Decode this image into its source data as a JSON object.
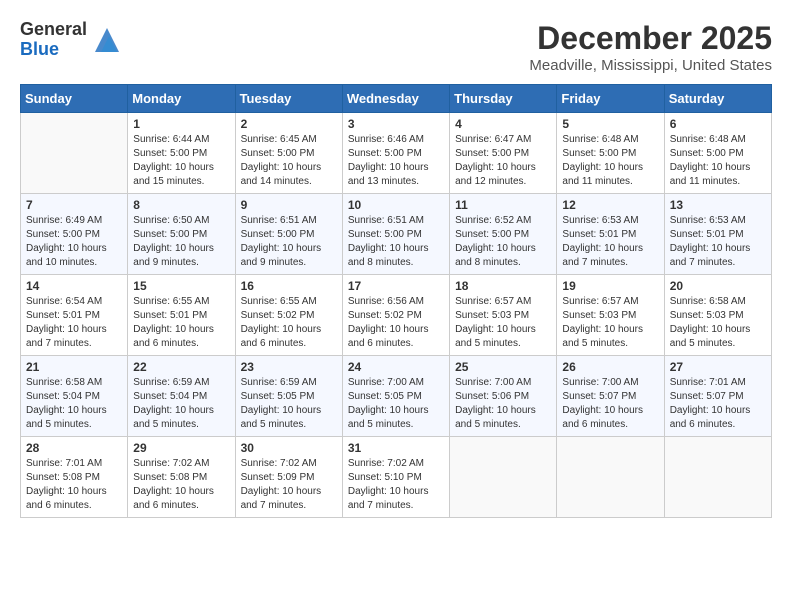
{
  "logo": {
    "general": "General",
    "blue": "Blue"
  },
  "header": {
    "month": "December 2025",
    "location": "Meadville, Mississippi, United States"
  },
  "weekdays": [
    "Sunday",
    "Monday",
    "Tuesday",
    "Wednesday",
    "Thursday",
    "Friday",
    "Saturday"
  ],
  "weeks": [
    [
      {
        "day": "",
        "empty": true
      },
      {
        "day": "1",
        "sunrise": "Sunrise: 6:44 AM",
        "sunset": "Sunset: 5:00 PM",
        "daylight": "Daylight: 10 hours and 15 minutes."
      },
      {
        "day": "2",
        "sunrise": "Sunrise: 6:45 AM",
        "sunset": "Sunset: 5:00 PM",
        "daylight": "Daylight: 10 hours and 14 minutes."
      },
      {
        "day": "3",
        "sunrise": "Sunrise: 6:46 AM",
        "sunset": "Sunset: 5:00 PM",
        "daylight": "Daylight: 10 hours and 13 minutes."
      },
      {
        "day": "4",
        "sunrise": "Sunrise: 6:47 AM",
        "sunset": "Sunset: 5:00 PM",
        "daylight": "Daylight: 10 hours and 12 minutes."
      },
      {
        "day": "5",
        "sunrise": "Sunrise: 6:48 AM",
        "sunset": "Sunset: 5:00 PM",
        "daylight": "Daylight: 10 hours and 11 minutes."
      },
      {
        "day": "6",
        "sunrise": "Sunrise: 6:48 AM",
        "sunset": "Sunset: 5:00 PM",
        "daylight": "Daylight: 10 hours and 11 minutes."
      }
    ],
    [
      {
        "day": "7",
        "sunrise": "Sunrise: 6:49 AM",
        "sunset": "Sunset: 5:00 PM",
        "daylight": "Daylight: 10 hours and 10 minutes."
      },
      {
        "day": "8",
        "sunrise": "Sunrise: 6:50 AM",
        "sunset": "Sunset: 5:00 PM",
        "daylight": "Daylight: 10 hours and 9 minutes."
      },
      {
        "day": "9",
        "sunrise": "Sunrise: 6:51 AM",
        "sunset": "Sunset: 5:00 PM",
        "daylight": "Daylight: 10 hours and 9 minutes."
      },
      {
        "day": "10",
        "sunrise": "Sunrise: 6:51 AM",
        "sunset": "Sunset: 5:00 PM",
        "daylight": "Daylight: 10 hours and 8 minutes."
      },
      {
        "day": "11",
        "sunrise": "Sunrise: 6:52 AM",
        "sunset": "Sunset: 5:00 PM",
        "daylight": "Daylight: 10 hours and 8 minutes."
      },
      {
        "day": "12",
        "sunrise": "Sunrise: 6:53 AM",
        "sunset": "Sunset: 5:01 PM",
        "daylight": "Daylight: 10 hours and 7 minutes."
      },
      {
        "day": "13",
        "sunrise": "Sunrise: 6:53 AM",
        "sunset": "Sunset: 5:01 PM",
        "daylight": "Daylight: 10 hours and 7 minutes."
      }
    ],
    [
      {
        "day": "14",
        "sunrise": "Sunrise: 6:54 AM",
        "sunset": "Sunset: 5:01 PM",
        "daylight": "Daylight: 10 hours and 7 minutes."
      },
      {
        "day": "15",
        "sunrise": "Sunrise: 6:55 AM",
        "sunset": "Sunset: 5:01 PM",
        "daylight": "Daylight: 10 hours and 6 minutes."
      },
      {
        "day": "16",
        "sunrise": "Sunrise: 6:55 AM",
        "sunset": "Sunset: 5:02 PM",
        "daylight": "Daylight: 10 hours and 6 minutes."
      },
      {
        "day": "17",
        "sunrise": "Sunrise: 6:56 AM",
        "sunset": "Sunset: 5:02 PM",
        "daylight": "Daylight: 10 hours and 6 minutes."
      },
      {
        "day": "18",
        "sunrise": "Sunrise: 6:57 AM",
        "sunset": "Sunset: 5:03 PM",
        "daylight": "Daylight: 10 hours and 5 minutes."
      },
      {
        "day": "19",
        "sunrise": "Sunrise: 6:57 AM",
        "sunset": "Sunset: 5:03 PM",
        "daylight": "Daylight: 10 hours and 5 minutes."
      },
      {
        "day": "20",
        "sunrise": "Sunrise: 6:58 AM",
        "sunset": "Sunset: 5:03 PM",
        "daylight": "Daylight: 10 hours and 5 minutes."
      }
    ],
    [
      {
        "day": "21",
        "sunrise": "Sunrise: 6:58 AM",
        "sunset": "Sunset: 5:04 PM",
        "daylight": "Daylight: 10 hours and 5 minutes."
      },
      {
        "day": "22",
        "sunrise": "Sunrise: 6:59 AM",
        "sunset": "Sunset: 5:04 PM",
        "daylight": "Daylight: 10 hours and 5 minutes."
      },
      {
        "day": "23",
        "sunrise": "Sunrise: 6:59 AM",
        "sunset": "Sunset: 5:05 PM",
        "daylight": "Daylight: 10 hours and 5 minutes."
      },
      {
        "day": "24",
        "sunrise": "Sunrise: 7:00 AM",
        "sunset": "Sunset: 5:05 PM",
        "daylight": "Daylight: 10 hours and 5 minutes."
      },
      {
        "day": "25",
        "sunrise": "Sunrise: 7:00 AM",
        "sunset": "Sunset: 5:06 PM",
        "daylight": "Daylight: 10 hours and 5 minutes."
      },
      {
        "day": "26",
        "sunrise": "Sunrise: 7:00 AM",
        "sunset": "Sunset: 5:07 PM",
        "daylight": "Daylight: 10 hours and 6 minutes."
      },
      {
        "day": "27",
        "sunrise": "Sunrise: 7:01 AM",
        "sunset": "Sunset: 5:07 PM",
        "daylight": "Daylight: 10 hours and 6 minutes."
      }
    ],
    [
      {
        "day": "28",
        "sunrise": "Sunrise: 7:01 AM",
        "sunset": "Sunset: 5:08 PM",
        "daylight": "Daylight: 10 hours and 6 minutes."
      },
      {
        "day": "29",
        "sunrise": "Sunrise: 7:02 AM",
        "sunset": "Sunset: 5:08 PM",
        "daylight": "Daylight: 10 hours and 6 minutes."
      },
      {
        "day": "30",
        "sunrise": "Sunrise: 7:02 AM",
        "sunset": "Sunset: 5:09 PM",
        "daylight": "Daylight: 10 hours and 7 minutes."
      },
      {
        "day": "31",
        "sunrise": "Sunrise: 7:02 AM",
        "sunset": "Sunset: 5:10 PM",
        "daylight": "Daylight: 10 hours and 7 minutes."
      },
      {
        "day": "",
        "empty": true
      },
      {
        "day": "",
        "empty": true
      },
      {
        "day": "",
        "empty": true
      }
    ]
  ]
}
